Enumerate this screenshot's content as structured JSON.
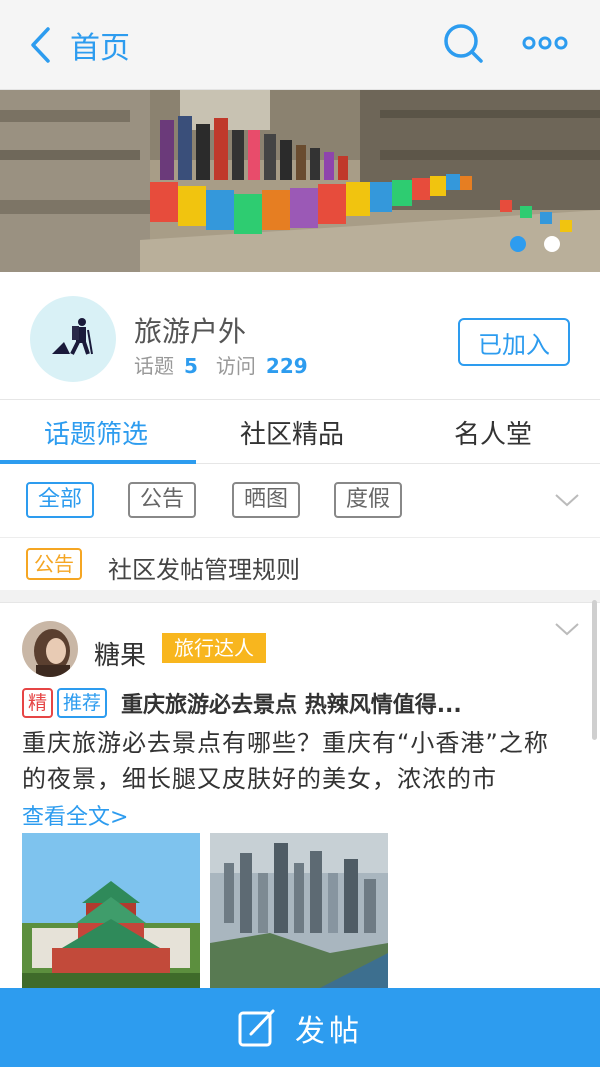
{
  "topbar": {
    "back_label": "首页",
    "icons": [
      "chevron-left-icon",
      "search-icon",
      "more-icon"
    ],
    "accent": "#2d9cef"
  },
  "banner": {
    "slides_total": 2,
    "active_slide": 1
  },
  "group": {
    "name": "旅游户外",
    "topics_label": "话题",
    "topics_count": "5",
    "visits_label": "访问",
    "visits_count": "229",
    "joined_label": "已加入"
  },
  "tabs": [
    {
      "label": "话题筛选",
      "active": true
    },
    {
      "label": "社区精品",
      "active": false
    },
    {
      "label": "名人堂",
      "active": false
    }
  ],
  "filters": [
    {
      "label": "全部",
      "active": true
    },
    {
      "label": "公告",
      "active": false
    },
    {
      "label": "晒图",
      "active": false
    },
    {
      "label": "度假",
      "active": false
    }
  ],
  "notice": {
    "tag": "公告",
    "title": "社区发帖管理规则"
  },
  "post": {
    "author": "糖果",
    "badge": "旅行达人",
    "tags": [
      "精",
      "推荐"
    ],
    "title": "重庆旅游必去景点 热辣风情值得...",
    "body": "重庆旅游必去景点有哪些？重庆有“小香港”之称的夜景，细长腿又皮肤好的美女，浓浓的市",
    "more_label": "查看全文>"
  },
  "compose": {
    "label": "发帖"
  },
  "colors": {
    "accent": "#2d9cef",
    "badge": "#f8b61e",
    "notice": "#f5a623",
    "featured": "#e64545"
  }
}
